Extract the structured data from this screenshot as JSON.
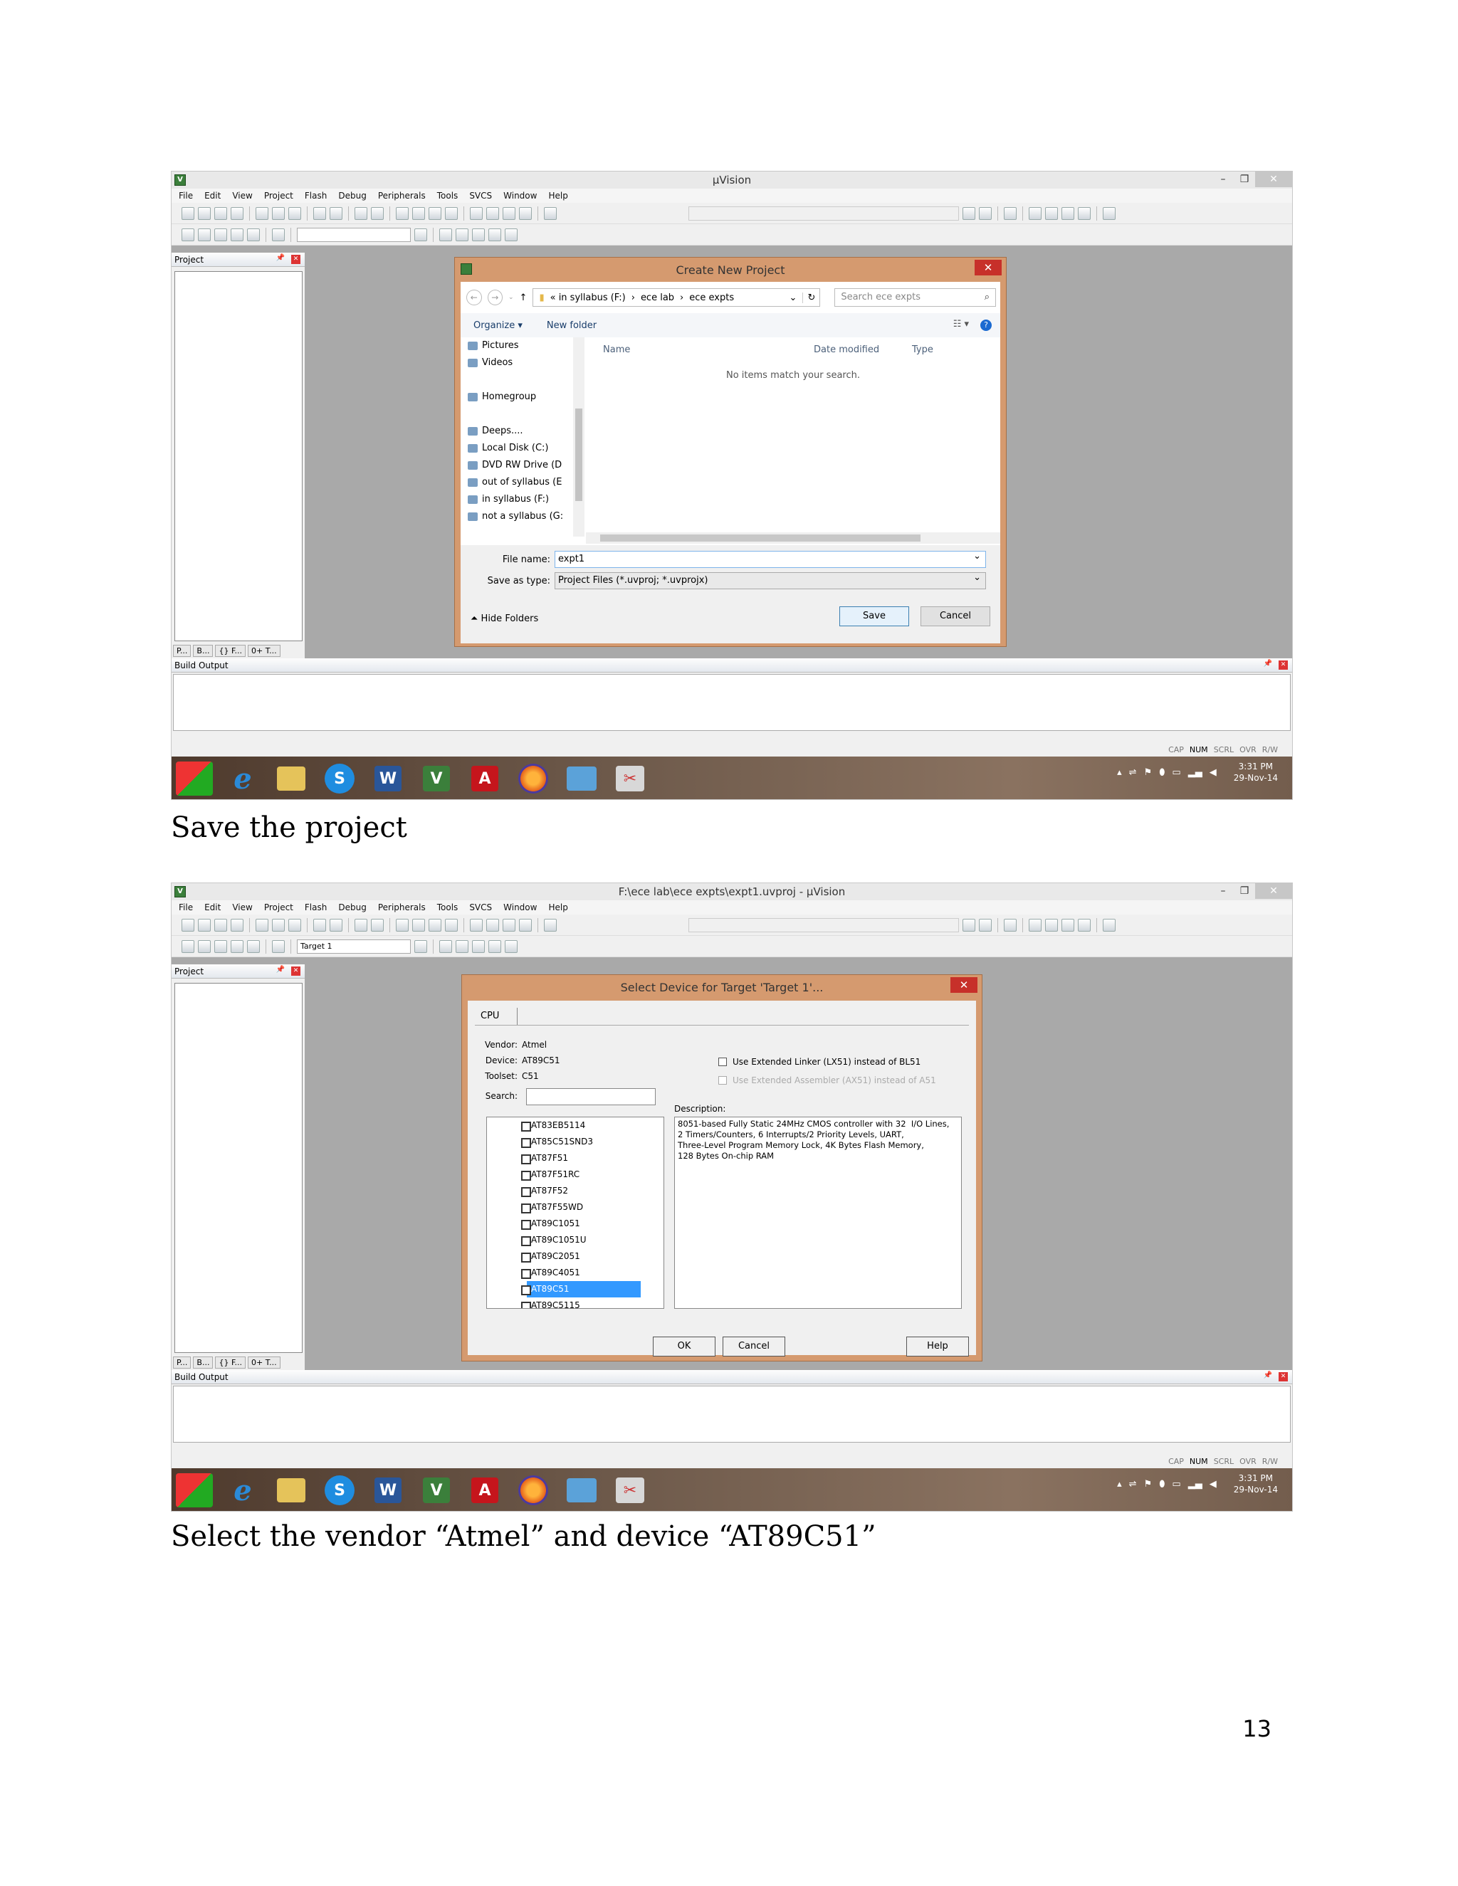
{
  "screen1": {
    "app_title": "µVision",
    "menus": [
      "File",
      "Edit",
      "View",
      "Project",
      "Flash",
      "Debug",
      "Peripherals",
      "Tools",
      "SVCS",
      "Window",
      "Help"
    ],
    "target_combo": "",
    "project_panel_title": "Project",
    "project_tabs": [
      "P...",
      "B...",
      "{} F...",
      "0+ T..."
    ],
    "build_output_title": "Build Output",
    "status_items": [
      "CAP",
      "NUM",
      "SCRL",
      "OVR",
      "R/W"
    ],
    "clock_time": "3:31 PM",
    "clock_date": "29-Nov-14",
    "dialog": {
      "title": "Create New Project",
      "breadcrumb": [
        "«  in syllabus (F:)",
        "ece lab",
        "ece expts"
      ],
      "search_placeholder": "Search ece expts",
      "organize_label": "Organize ▾",
      "new_folder_label": "New folder",
      "nav_items": [
        "Pictures",
        "Videos",
        "Homegroup",
        "Deeps....",
        "Local Disk (C:)",
        "DVD RW Drive (D",
        "out of syllabus (E",
        "in syllabus (F:)",
        "not a syllabus (G:"
      ],
      "columns": {
        "name": "Name",
        "date": "Date modified",
        "type": "Type"
      },
      "empty_message": "No items match your search.",
      "file_name_label": "File name:",
      "file_name_value": "expt1",
      "save_type_label": "Save as type:",
      "save_type_value": "Project Files (*.uvproj; *.uvprojx)",
      "hide_folders_label": "Hide Folders",
      "save_label": "Save",
      "cancel_label": "Cancel"
    }
  },
  "caption1": "Save the project",
  "screen2": {
    "app_title": "F:\\ece lab\\ece expts\\expt1.uvproj - µVision",
    "menus": [
      "File",
      "Edit",
      "View",
      "Project",
      "Flash",
      "Debug",
      "Peripherals",
      "Tools",
      "SVCS",
      "Window",
      "Help"
    ],
    "target_combo": "Target 1",
    "project_panel_title": "Project",
    "project_tabs": [
      "P...",
      "B...",
      "{} F...",
      "0+ T..."
    ],
    "build_output_title": "Build Output",
    "status_items": [
      "CAP",
      "NUM",
      "SCRL",
      "OVR",
      "R/W"
    ],
    "clock_time": "3:31 PM",
    "clock_date": "29-Nov-14",
    "dialog": {
      "title": "Select Device for Target 'Target 1'...",
      "tab_label": "CPU",
      "vendor_label": "Vendor:",
      "vendor_value": "Atmel",
      "device_label": "Device:",
      "device_value": "AT89C51",
      "toolset_label": "Toolset:",
      "toolset_value": "C51",
      "search_label": "Search:",
      "ext_linker_label": "Use Extended Linker (LX51) instead of BL51",
      "ext_assembler_label": "Use Extended Assembler (AX51) instead of A51",
      "description_label": "Description:",
      "description": "8051-based Fully Static 24MHz CMOS controller with 32  I/O Lines,\n2 Timers/Counters, 6 Interrupts/2 Priority Levels, UART,\nThree-Level Program Memory Lock, 4K Bytes Flash Memory,\n128 Bytes On-chip RAM",
      "devices": [
        "AT83EB5114",
        "AT85C51SND3",
        "AT87F51",
        "AT87F51RC",
        "AT87F52",
        "AT87F55WD",
        "AT89C1051",
        "AT89C1051U",
        "AT89C2051",
        "AT89C4051",
        "AT89C51",
        "AT89C5115"
      ],
      "selected_device": "AT89C51",
      "ok_label": "OK",
      "cancel_label": "Cancel",
      "help_label": "Help"
    }
  },
  "caption2": "Select the vendor “Atmel” and device “AT89C51”",
  "page_number": "13"
}
